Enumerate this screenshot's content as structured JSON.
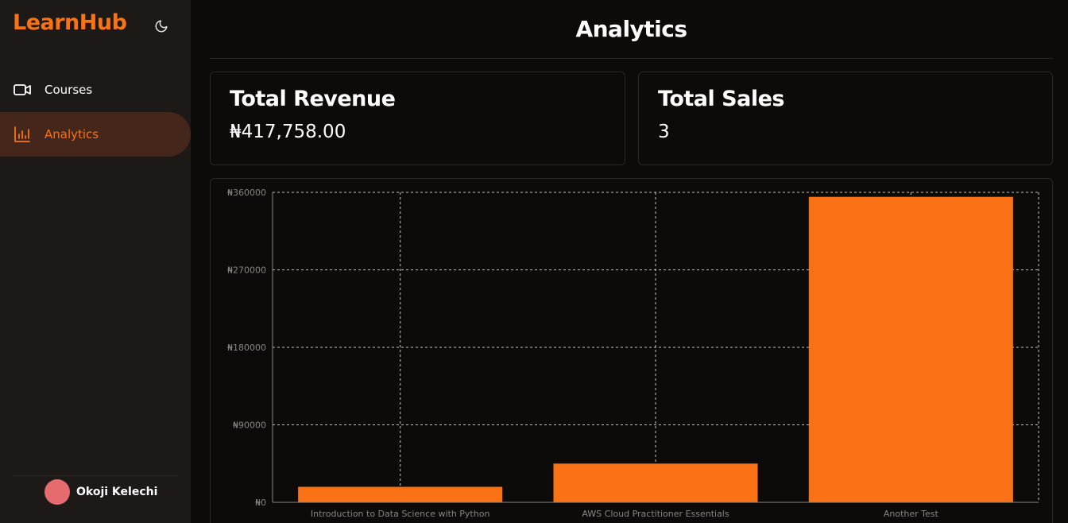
{
  "sidebar": {
    "brand": "LearnHub",
    "items": [
      {
        "label": "Courses",
        "icon": "video-camera-icon"
      },
      {
        "label": "Analytics",
        "icon": "bar-chart-icon"
      }
    ],
    "user": {
      "name": "Okoji Kelechi"
    }
  },
  "main": {
    "title": "Analytics",
    "cards": [
      {
        "title": "Total Revenue",
        "value": "₦417,758.00"
      },
      {
        "title": "Total Sales",
        "value": "3"
      }
    ]
  },
  "colors": {
    "accent": "#f97316",
    "sidebar_bg": "#1c1917",
    "active_item_bg": "#45261a",
    "page_bg": "#0d0b0a",
    "avatar": "#e56b6f"
  },
  "chart_data": {
    "type": "bar",
    "categories": [
      "Introduction to Data Science with Python",
      "AWS Cloud Practitioner Essentials",
      "Another Test"
    ],
    "values": [
      18000,
      45000,
      354758
    ],
    "ylim": [
      0,
      360000
    ],
    "yticks": [
      0,
      90000,
      180000,
      270000,
      360000
    ],
    "ytick_labels": [
      "₦0",
      "₦90000",
      "₦180000",
      "₦270000",
      "₦360000"
    ],
    "grid": true,
    "bar_color": "#f97316",
    "title": "",
    "xlabel": "",
    "ylabel": ""
  }
}
